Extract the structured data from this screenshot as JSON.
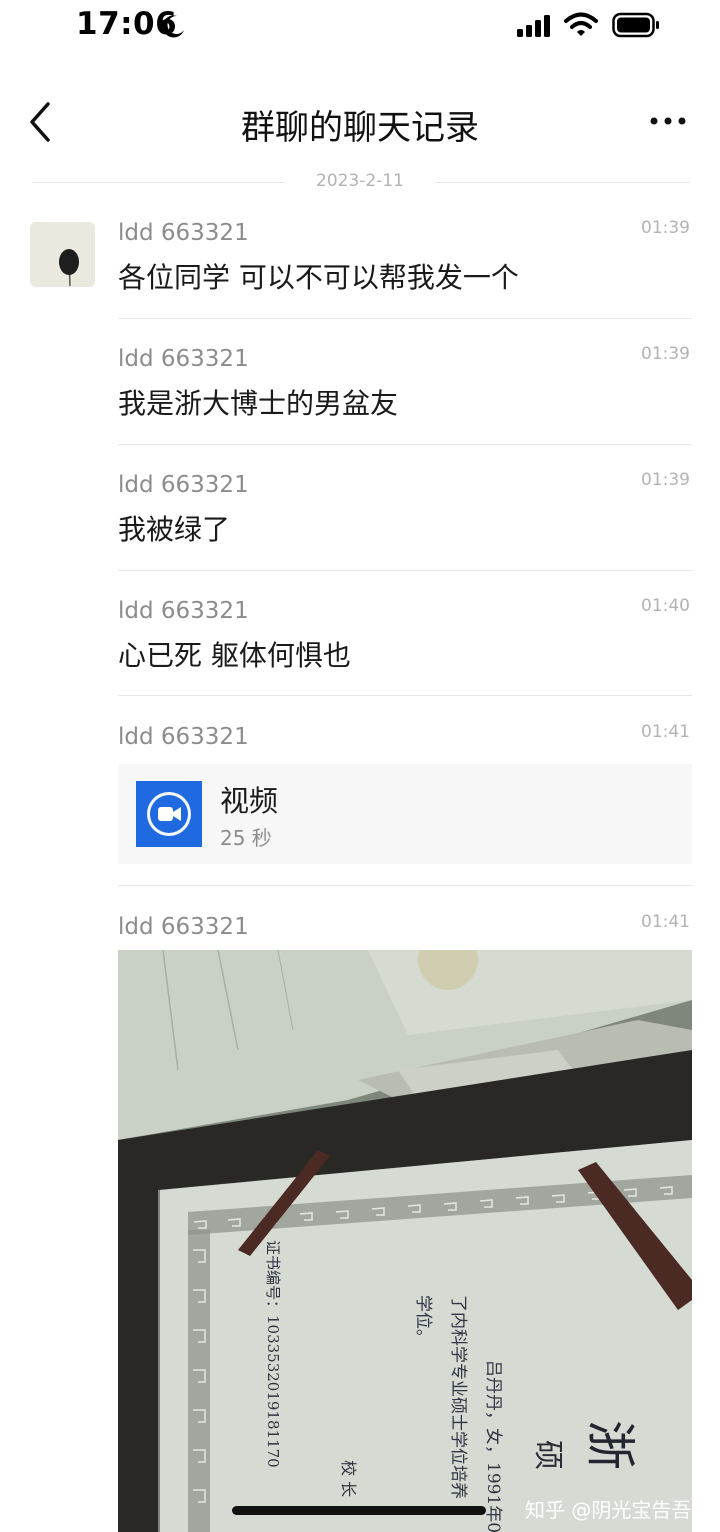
{
  "status_bar": {
    "time": "17:06"
  },
  "nav": {
    "title": "群聊的聊天记录"
  },
  "date_divider": "2023-2-11",
  "messages": [
    {
      "sender": "ldd 663321",
      "time": "01:39",
      "text": "各位同学 可以不可以帮我发一个"
    },
    {
      "sender": "ldd 663321",
      "time": "01:39",
      "text": "我是浙大博士的男盆友"
    },
    {
      "sender": "ldd 663321",
      "time": "01:39",
      "text": "我被绿了"
    },
    {
      "sender": "ldd 663321",
      "time": "01:40",
      "text": "心已死 躯体何惧也"
    },
    {
      "sender": "ldd 663321",
      "time": "01:41",
      "video": {
        "title": "视频",
        "duration": "25 秒"
      }
    },
    {
      "sender": "ldd 663321",
      "time": "01:41"
    }
  ],
  "certificate_text": {
    "serial": "证书编号：10335320191811​70",
    "name_line": "吕丹丹，女，1991年0",
    "major_line": "了内科学专业硕士学位培养",
    "degree_line": "学位。",
    "big_chars": "硕",
    "school_chars": "浙",
    "president": "校 长"
  },
  "watermark": "知乎 @阴光宝告吾"
}
